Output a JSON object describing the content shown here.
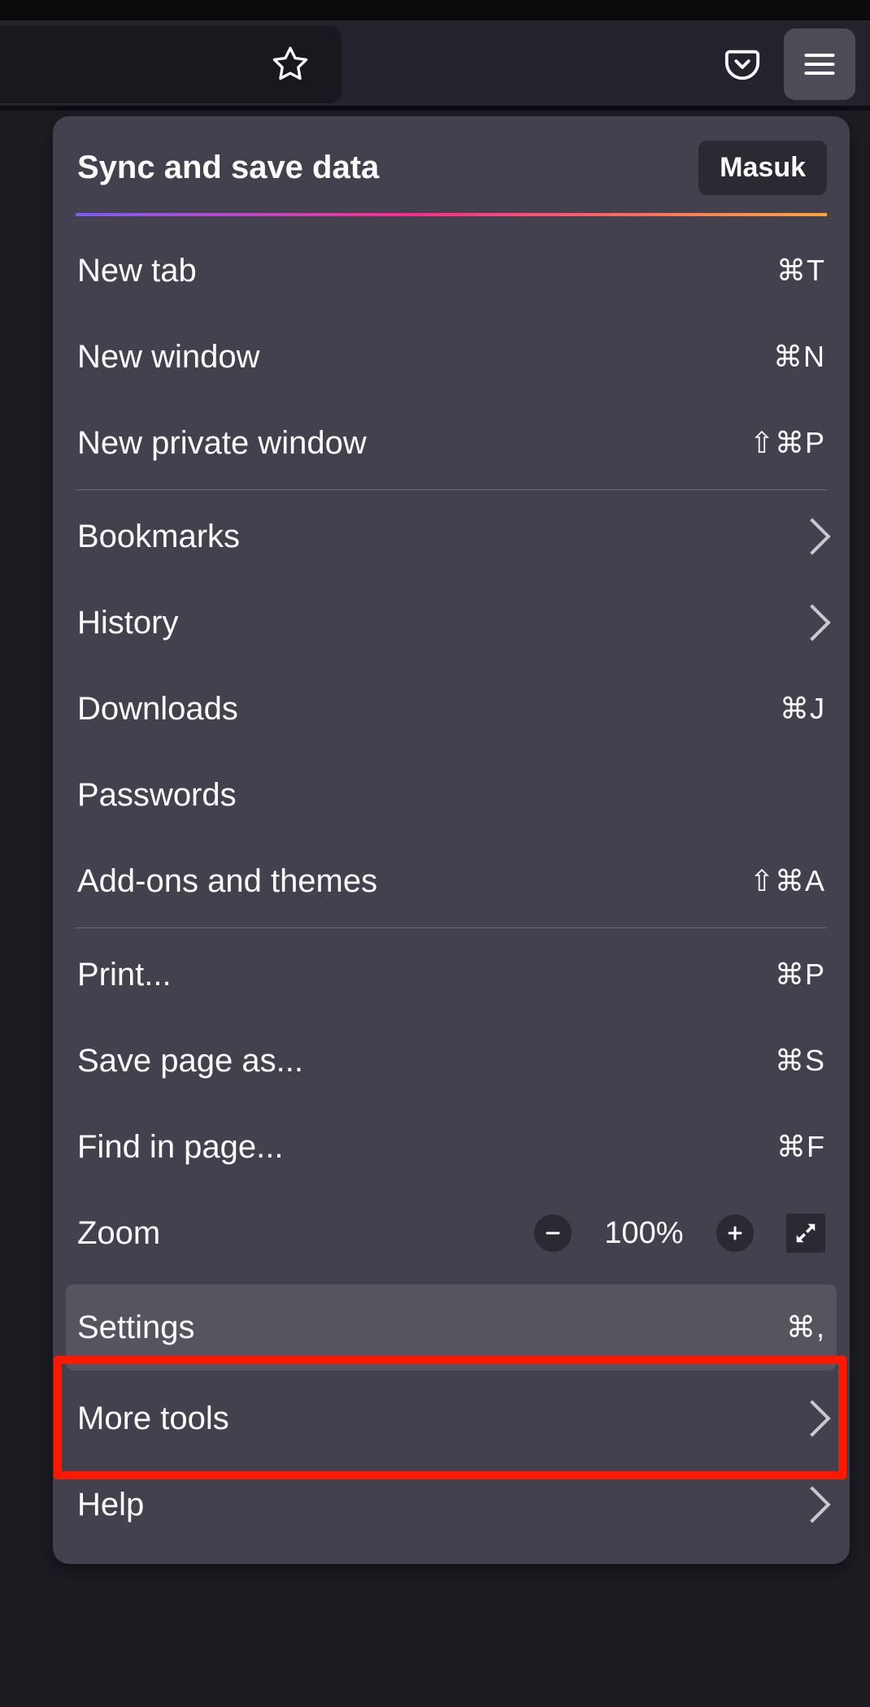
{
  "toolbar": {
    "star_icon": "star",
    "pocket_icon": "pocket",
    "menu_icon": "menu"
  },
  "sync": {
    "title": "Sync and save data",
    "login_label": "Masuk"
  },
  "items_a": [
    {
      "label": "New tab",
      "shortcut": "⌘T"
    },
    {
      "label": "New window",
      "shortcut": "⌘N"
    },
    {
      "label": "New private window",
      "shortcut": "⇧⌘P"
    }
  ],
  "items_b": [
    {
      "label": "Bookmarks",
      "type": "submenu"
    },
    {
      "label": "History",
      "type": "submenu"
    },
    {
      "label": "Downloads",
      "shortcut": "⌘J"
    },
    {
      "label": "Passwords"
    },
    {
      "label": "Add-ons and themes",
      "shortcut": "⇧⌘A"
    }
  ],
  "items_c": [
    {
      "label": "Print...",
      "shortcut": "⌘P"
    },
    {
      "label": "Save page as...",
      "shortcut": "⌘S"
    },
    {
      "label": "Find in page...",
      "shortcut": "⌘F"
    }
  ],
  "zoom": {
    "label": "Zoom",
    "value": "100%",
    "minus": "−",
    "plus": "+"
  },
  "settings": {
    "label": "Settings",
    "shortcut": "⌘,"
  },
  "items_d": [
    {
      "label": "More tools",
      "type": "submenu"
    },
    {
      "label": "Help",
      "type": "submenu"
    }
  ],
  "highlight_target": "settings"
}
